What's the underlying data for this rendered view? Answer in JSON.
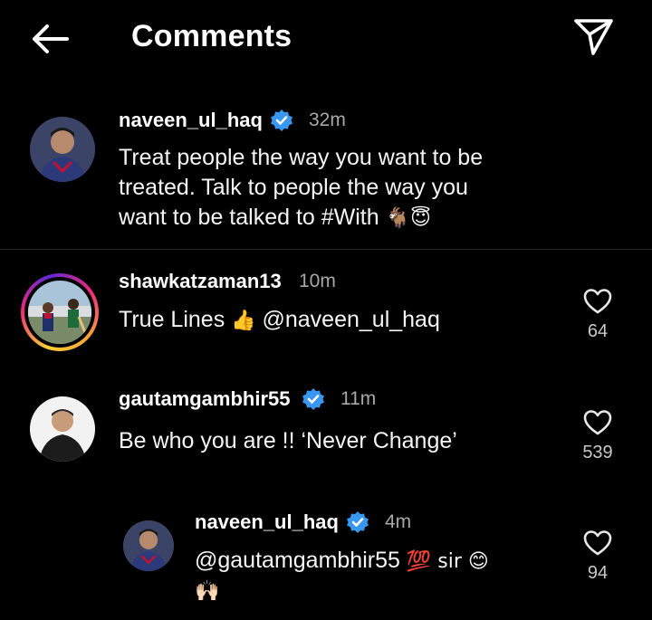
{
  "header": {
    "title": "Comments",
    "back_icon": "arrow-left-icon",
    "share_icon": "paper-plane-icon"
  },
  "caption": {
    "username": "naveen_ul_haq",
    "verified": true,
    "time": "32m",
    "lines": [
      "Treat people the way you want to be",
      "treated. Talk to people the way you",
      "want to be talked to #With"
    ],
    "emojis": "🐐😇"
  },
  "comments": [
    {
      "username": "shawkatzaman13",
      "verified": false,
      "time": "10m",
      "text_before": "True Lines ",
      "emoji": "👍",
      "text_after": " @naveen_ul_haq",
      "likes": "64",
      "has_story": true
    },
    {
      "username": "gautamgambhir55",
      "verified": true,
      "time": "11m",
      "text": "Be who you are !! ‘Never Change’",
      "likes": "539"
    }
  ],
  "reply": {
    "username": "naveen_ul_haq",
    "verified": true,
    "time": "4m",
    "text": "@gautamgambhir55",
    "emoji_line1": "💯 sir 😊",
    "emoji_line2": "🙌🏻",
    "likes": "94"
  },
  "colors": {
    "background": "#000000",
    "verified_blue": "#3897f0",
    "muted_text": "#a8a8a8",
    "divider": "#262626"
  }
}
